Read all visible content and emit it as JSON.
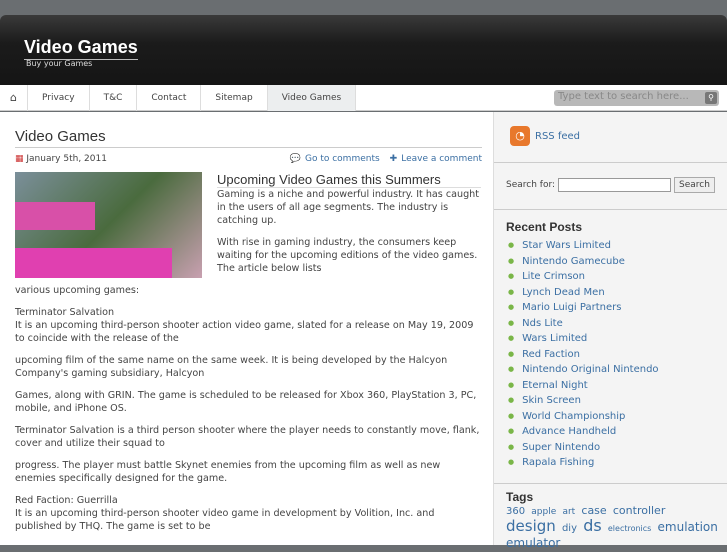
{
  "header": {
    "title": "Video Games",
    "tagline": "Buy your Games"
  },
  "nav": {
    "home_icon": "home-icon",
    "items": [
      "Privacy",
      "T&C",
      "Contact",
      "Sitemap",
      "Video Games"
    ],
    "search_placeholder": "Type text to search here..."
  },
  "post": {
    "title": "Video Games",
    "date": "January 5th, 2011",
    "go_comments": "Go to comments",
    "leave_comment": "Leave a comment",
    "subtitle": "Upcoming Video Games this Summers",
    "paragraphs": [
      "Gaming is a niche and powerful industry. It has caught in the users of all age segments. The industry is catching up.",
      "With rise in gaming industry, the consumers keep waiting for the upcoming editions of the video games. The article below lists"
    ],
    "body": [
      "various upcoming games:",
      "Terminator Salvation\nIt is an upcoming third-person shooter action video game, slated for a release on May 19, 2009 to coincide with the release of the",
      "upcoming film of the same name on the same week. It is being developed by the Halcyon Company's gaming subsidiary, Halcyon",
      "Games, along with GRIN. The game is scheduled to be released for Xbox 360, PlayStation 3, PC, mobile, and iPhone OS.",
      "Terminator Salvation is a third person shooter where the player needs to constantly move, flank, cover and utilize their squad to",
      "progress. The player must battle Skynet enemies from the upcoming film as well as new enemies specifically designed for the game.",
      "Red Faction: Guerrilla\nIt is an upcoming third-person shooter video game in development by Volition, Inc. and published by THQ. The game is set to be"
    ]
  },
  "sidebar": {
    "rss": "RSS feed",
    "search_label": "Search for:",
    "search_button": "Search",
    "recent_title": "Recent Posts",
    "recent": [
      "Star Wars Limited",
      "Nintendo Gamecube",
      "Lite Crimson",
      "Lynch Dead Men",
      "Mario Luigi Partners",
      "Nds Lite",
      "Wars Limited",
      "Red Faction",
      "Nintendo Original Nintendo",
      "Eternal Night",
      "Skin Screen",
      "World Championship",
      "Advance Handheld",
      "Super Nintendo",
      "Rapala Fishing"
    ],
    "tags_title": "Tags",
    "tags": [
      "360",
      "apple",
      "art",
      "case",
      "controller",
      "design",
      "diy",
      "ds",
      "electronics",
      "emulation",
      "emulator"
    ]
  }
}
